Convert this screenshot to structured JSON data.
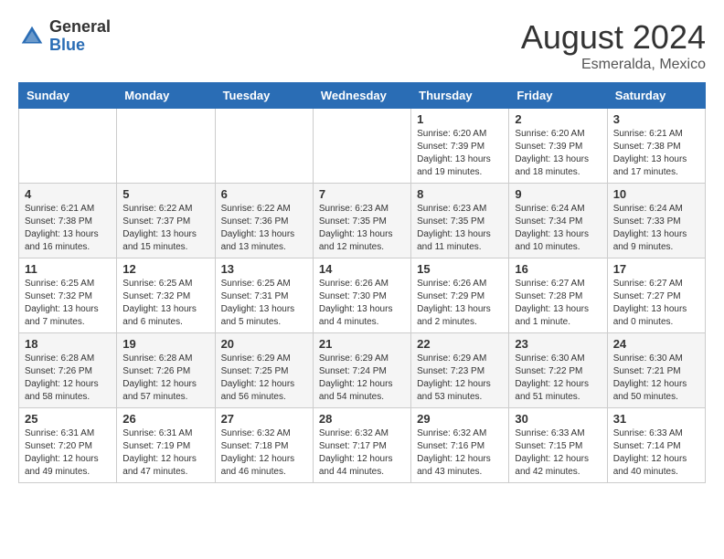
{
  "header": {
    "logo_general": "General",
    "logo_blue": "Blue",
    "month_year": "August 2024",
    "location": "Esmeralda, Mexico"
  },
  "days_of_week": [
    "Sunday",
    "Monday",
    "Tuesday",
    "Wednesday",
    "Thursday",
    "Friday",
    "Saturday"
  ],
  "weeks": [
    [
      {
        "day": "",
        "info": ""
      },
      {
        "day": "",
        "info": ""
      },
      {
        "day": "",
        "info": ""
      },
      {
        "day": "",
        "info": ""
      },
      {
        "day": "1",
        "info": "Sunrise: 6:20 AM\nSunset: 7:39 PM\nDaylight: 13 hours\nand 19 minutes."
      },
      {
        "day": "2",
        "info": "Sunrise: 6:20 AM\nSunset: 7:39 PM\nDaylight: 13 hours\nand 18 minutes."
      },
      {
        "day": "3",
        "info": "Sunrise: 6:21 AM\nSunset: 7:38 PM\nDaylight: 13 hours\nand 17 minutes."
      }
    ],
    [
      {
        "day": "4",
        "info": "Sunrise: 6:21 AM\nSunset: 7:38 PM\nDaylight: 13 hours\nand 16 minutes."
      },
      {
        "day": "5",
        "info": "Sunrise: 6:22 AM\nSunset: 7:37 PM\nDaylight: 13 hours\nand 15 minutes."
      },
      {
        "day": "6",
        "info": "Sunrise: 6:22 AM\nSunset: 7:36 PM\nDaylight: 13 hours\nand 13 minutes."
      },
      {
        "day": "7",
        "info": "Sunrise: 6:23 AM\nSunset: 7:35 PM\nDaylight: 13 hours\nand 12 minutes."
      },
      {
        "day": "8",
        "info": "Sunrise: 6:23 AM\nSunset: 7:35 PM\nDaylight: 13 hours\nand 11 minutes."
      },
      {
        "day": "9",
        "info": "Sunrise: 6:24 AM\nSunset: 7:34 PM\nDaylight: 13 hours\nand 10 minutes."
      },
      {
        "day": "10",
        "info": "Sunrise: 6:24 AM\nSunset: 7:33 PM\nDaylight: 13 hours\nand 9 minutes."
      }
    ],
    [
      {
        "day": "11",
        "info": "Sunrise: 6:25 AM\nSunset: 7:32 PM\nDaylight: 13 hours\nand 7 minutes."
      },
      {
        "day": "12",
        "info": "Sunrise: 6:25 AM\nSunset: 7:32 PM\nDaylight: 13 hours\nand 6 minutes."
      },
      {
        "day": "13",
        "info": "Sunrise: 6:25 AM\nSunset: 7:31 PM\nDaylight: 13 hours\nand 5 minutes."
      },
      {
        "day": "14",
        "info": "Sunrise: 6:26 AM\nSunset: 7:30 PM\nDaylight: 13 hours\nand 4 minutes."
      },
      {
        "day": "15",
        "info": "Sunrise: 6:26 AM\nSunset: 7:29 PM\nDaylight: 13 hours\nand 2 minutes."
      },
      {
        "day": "16",
        "info": "Sunrise: 6:27 AM\nSunset: 7:28 PM\nDaylight: 13 hours\nand 1 minute."
      },
      {
        "day": "17",
        "info": "Sunrise: 6:27 AM\nSunset: 7:27 PM\nDaylight: 13 hours\nand 0 minutes."
      }
    ],
    [
      {
        "day": "18",
        "info": "Sunrise: 6:28 AM\nSunset: 7:26 PM\nDaylight: 12 hours\nand 58 minutes."
      },
      {
        "day": "19",
        "info": "Sunrise: 6:28 AM\nSunset: 7:26 PM\nDaylight: 12 hours\nand 57 minutes."
      },
      {
        "day": "20",
        "info": "Sunrise: 6:29 AM\nSunset: 7:25 PM\nDaylight: 12 hours\nand 56 minutes."
      },
      {
        "day": "21",
        "info": "Sunrise: 6:29 AM\nSunset: 7:24 PM\nDaylight: 12 hours\nand 54 minutes."
      },
      {
        "day": "22",
        "info": "Sunrise: 6:29 AM\nSunset: 7:23 PM\nDaylight: 12 hours\nand 53 minutes."
      },
      {
        "day": "23",
        "info": "Sunrise: 6:30 AM\nSunset: 7:22 PM\nDaylight: 12 hours\nand 51 minutes."
      },
      {
        "day": "24",
        "info": "Sunrise: 6:30 AM\nSunset: 7:21 PM\nDaylight: 12 hours\nand 50 minutes."
      }
    ],
    [
      {
        "day": "25",
        "info": "Sunrise: 6:31 AM\nSunset: 7:20 PM\nDaylight: 12 hours\nand 49 minutes."
      },
      {
        "day": "26",
        "info": "Sunrise: 6:31 AM\nSunset: 7:19 PM\nDaylight: 12 hours\nand 47 minutes."
      },
      {
        "day": "27",
        "info": "Sunrise: 6:32 AM\nSunset: 7:18 PM\nDaylight: 12 hours\nand 46 minutes."
      },
      {
        "day": "28",
        "info": "Sunrise: 6:32 AM\nSunset: 7:17 PM\nDaylight: 12 hours\nand 44 minutes."
      },
      {
        "day": "29",
        "info": "Sunrise: 6:32 AM\nSunset: 7:16 PM\nDaylight: 12 hours\nand 43 minutes."
      },
      {
        "day": "30",
        "info": "Sunrise: 6:33 AM\nSunset: 7:15 PM\nDaylight: 12 hours\nand 42 minutes."
      },
      {
        "day": "31",
        "info": "Sunrise: 6:33 AM\nSunset: 7:14 PM\nDaylight: 12 hours\nand 40 minutes."
      }
    ]
  ],
  "colors": {
    "header_bg": "#2a6db5",
    "accent_blue": "#2a6db5"
  }
}
